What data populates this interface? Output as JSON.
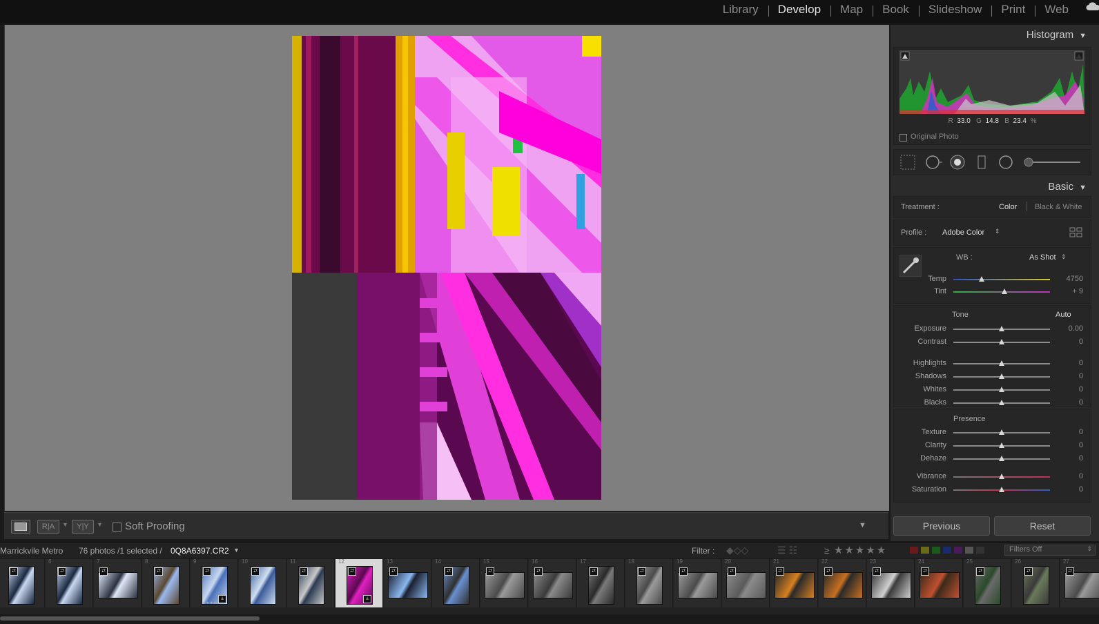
{
  "modules": [
    "Library",
    "Develop",
    "Map",
    "Book",
    "Slideshow",
    "Print",
    "Web"
  ],
  "active_module": "Develop",
  "histogram": {
    "title": "Histogram",
    "r_label": "R",
    "r": "33.0",
    "g_label": "G",
    "g": "14.8",
    "b_label": "B",
    "b": "23.4",
    "unit": "%",
    "original_photo": "Original Photo"
  },
  "basic": {
    "title": "Basic",
    "treatment_label": "Treatment :",
    "treatment_color": "Color",
    "treatment_bw": "Black & White",
    "profile_label": "Profile :",
    "profile_value": "Adobe Color",
    "wb_label": "WB :",
    "wb_value": "As Shot",
    "temp_label": "Temp",
    "temp_value": "4750",
    "tint_label": "Tint",
    "tint_value": "+ 9",
    "tone_label": "Tone",
    "auto_label": "Auto",
    "exposure_label": "Exposure",
    "exposure_value": "0.00",
    "contrast_label": "Contrast",
    "contrast_value": "0",
    "highlights_label": "Highlights",
    "highlights_value": "0",
    "shadows_label": "Shadows",
    "shadows_value": "0",
    "whites_label": "Whites",
    "whites_value": "0",
    "blacks_label": "Blacks",
    "blacks_value": "0",
    "presence_label": "Presence",
    "texture_label": "Texture",
    "texture_value": "0",
    "clarity_label": "Clarity",
    "clarity_value": "0",
    "dehaze_label": "Dehaze",
    "dehaze_value": "0",
    "vibrance_label": "Vibrance",
    "vibrance_value": "0",
    "saturation_label": "Saturation",
    "saturation_value": "0"
  },
  "buttons": {
    "previous": "Previous",
    "reset": "Reset"
  },
  "toolbar": {
    "ra": "R|A",
    "yy": "Y|Y",
    "soft_proofing": "Soft Proofing"
  },
  "filmbar": {
    "source": "Marrickvile Metro",
    "count": "76 photos /1 selected /",
    "filename": "0Q8A6397.CR2",
    "filter_label": "Filter :",
    "rating_op": "≥",
    "filters_off": "Filters Off"
  },
  "filmstrip": {
    "numbers": [
      "",
      "6",
      "7",
      "8",
      "9",
      "10",
      "11",
      "12",
      "13",
      "14",
      "15",
      "16",
      "17",
      "18",
      "19",
      "20",
      "21",
      "22",
      "23",
      "24",
      "25",
      "26",
      "27"
    ],
    "stars": "★★★★★",
    "selected_index": 7
  },
  "colors": {
    "accent_selected": "#d8d8d8",
    "canvas_bg": "#7f7f7f",
    "panel_bg": "#2b2b2b"
  }
}
